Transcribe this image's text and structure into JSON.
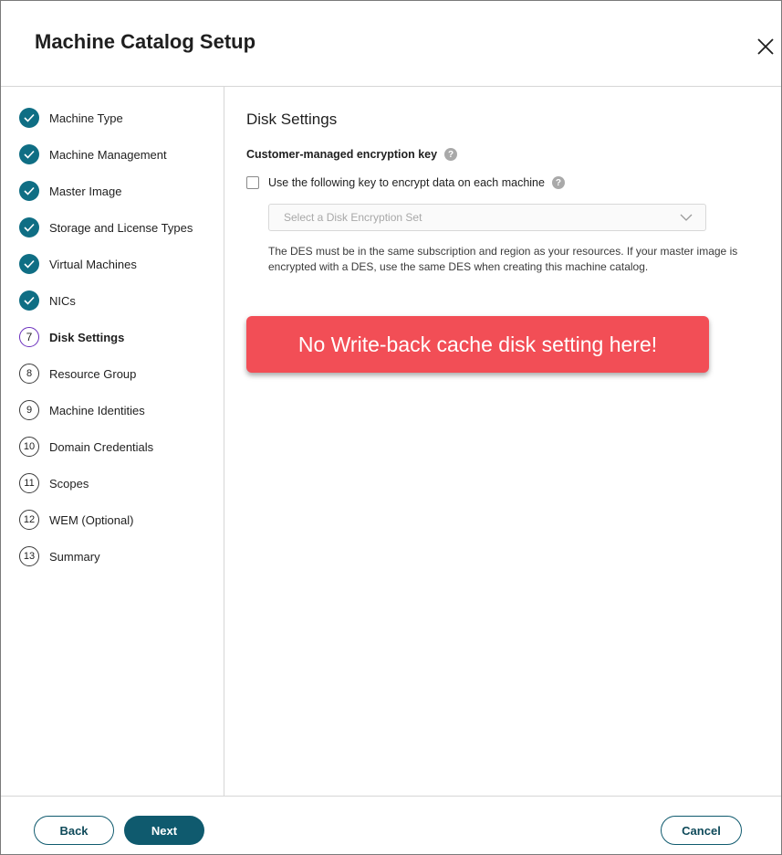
{
  "dialog": {
    "title": "Machine Catalog Setup"
  },
  "steps": [
    {
      "label": "Machine Type",
      "state": "done"
    },
    {
      "label": "Machine Management",
      "state": "done"
    },
    {
      "label": "Master Image",
      "state": "done"
    },
    {
      "label": "Storage and License Types",
      "state": "done"
    },
    {
      "label": "Virtual Machines",
      "state": "done"
    },
    {
      "label": "NICs",
      "state": "done"
    },
    {
      "label": "Disk Settings",
      "state": "current",
      "num": "7"
    },
    {
      "label": "Resource Group",
      "state": "todo",
      "num": "8"
    },
    {
      "label": "Machine Identities",
      "state": "todo",
      "num": "9"
    },
    {
      "label": "Domain Credentials",
      "state": "todo",
      "num": "10"
    },
    {
      "label": "Scopes",
      "state": "todo",
      "num": "11"
    },
    {
      "label": "WEM (Optional)",
      "state": "todo",
      "num": "12"
    },
    {
      "label": "Summary",
      "state": "todo",
      "num": "13"
    }
  ],
  "content": {
    "section_title": "Disk Settings",
    "key_label": "Customer-managed encryption key",
    "checkbox_label": "Use the following key to encrypt data on each machine",
    "checkbox_checked": false,
    "select_placeholder": "Select a Disk Encryption Set",
    "note": "The DES must be in the same subscription and region as your resources. If your master image is encrypted with a DES, use the same DES when creating this machine catalog.",
    "callout": "No Write-back cache disk setting here!"
  },
  "footer": {
    "back": "Back",
    "next": "Next",
    "cancel": "Cancel"
  },
  "colors": {
    "primary": "#0f5a6e",
    "check": "#0f6e84",
    "current": "#6a2ebd",
    "callout": "#f24e56"
  }
}
